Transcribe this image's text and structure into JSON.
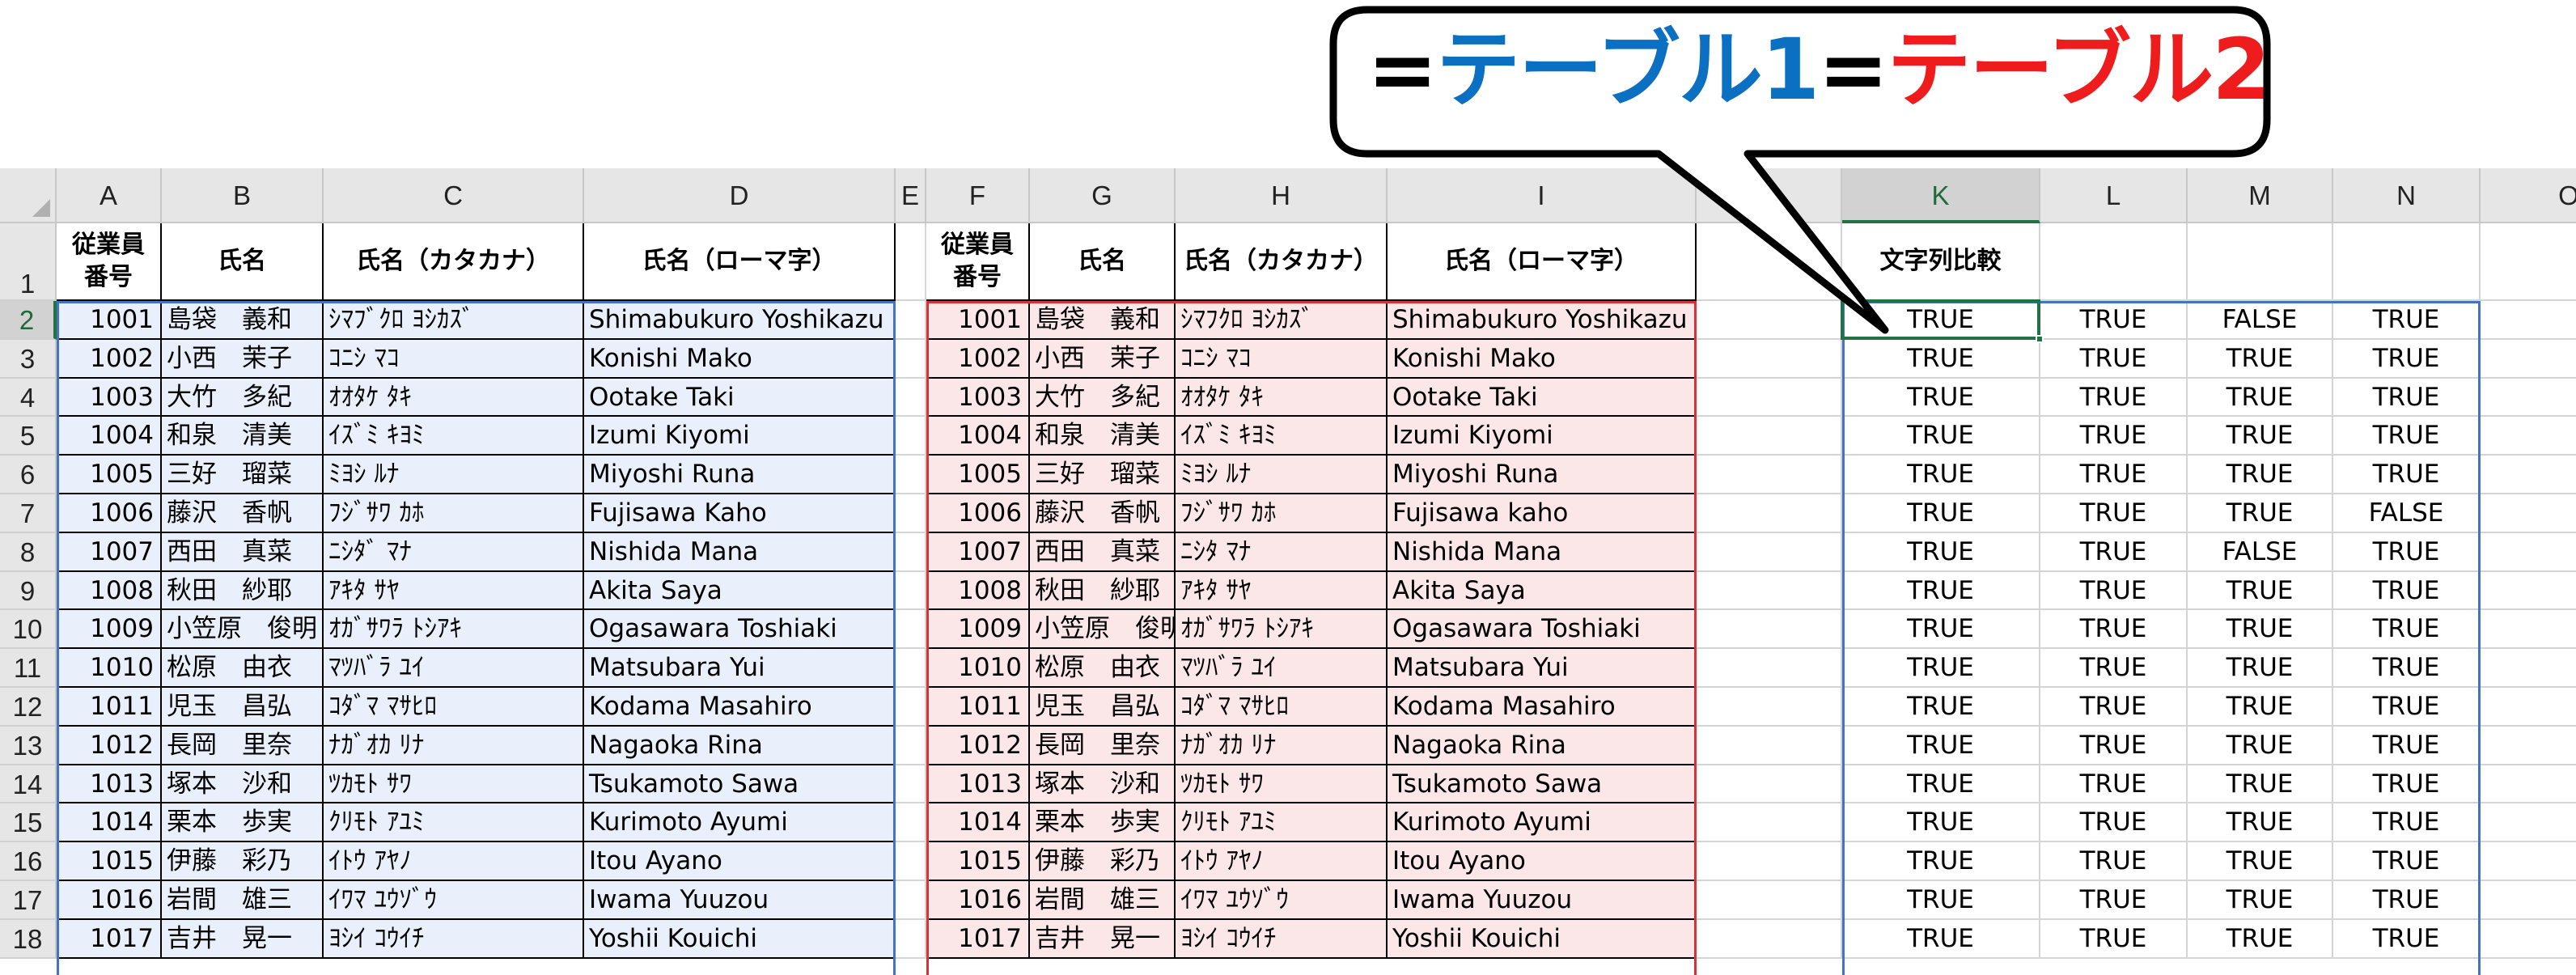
{
  "callout": {
    "eq1": "=",
    "table1": "テーブル1",
    "eq2": "=",
    "table2": "テーブル2",
    "colors": {
      "table1": "#0b6fc2",
      "table2": "#ee1c1c",
      "eq": "#000000"
    }
  },
  "sheet": {
    "columns": [
      "A",
      "B",
      "C",
      "D",
      "E",
      "F",
      "G",
      "H",
      "I",
      "J",
      "K",
      "L",
      "M",
      "N",
      "O"
    ],
    "selected_column": "K",
    "selected_row": "2",
    "row_numbers": [
      "1",
      "2",
      "3",
      "4",
      "5",
      "6",
      "7",
      "8",
      "9",
      "10",
      "11",
      "12",
      "13",
      "14",
      "15",
      "16",
      "17",
      "18"
    ],
    "table1_headers": [
      "従業員番号",
      "氏名",
      "氏名（カタカナ）",
      "氏名（ローマ字）"
    ],
    "table2_headers": [
      "従業員番号",
      "氏名",
      "氏名（カタカナ）",
      "氏名（ローマ字）"
    ],
    "compare_header": "文字列比較",
    "table1_rows": [
      [
        "1001",
        "島袋　義和",
        "ｼﾏﾌﾞｸﾛ ﾖｼｶｽﾞ",
        "Shimabukuro Yoshikazu"
      ],
      [
        "1002",
        "小西　茉子",
        "ｺﾆｼ ﾏｺ",
        "Konishi Mako"
      ],
      [
        "1003",
        "大竹　多紀",
        "ｵｵﾀｹ ﾀｷ",
        "Ootake Taki"
      ],
      [
        "1004",
        "和泉　清美",
        "ｲｽﾞﾐ ｷﾖﾐ",
        "Izumi Kiyomi"
      ],
      [
        "1005",
        "三好　瑠菜",
        "ﾐﾖｼ ﾙﾅ",
        "Miyoshi Runa"
      ],
      [
        "1006",
        "藤沢　香帆",
        "ﾌｼﾞｻﾜ ｶﾎ",
        "Fujisawa Kaho"
      ],
      [
        "1007",
        "西田　真菜",
        "ﾆｼﾀﾞ ﾏﾅ",
        "Nishida Mana"
      ],
      [
        "1008",
        "秋田　紗耶",
        "ｱｷﾀ ｻﾔ",
        "Akita Saya"
      ],
      [
        "1009",
        "小笠原　俊明",
        "ｵｶﾞｻﾜﾗ ﾄｼｱｷ",
        "Ogasawara Toshiaki"
      ],
      [
        "1010",
        "松原　由衣",
        "ﾏﾂﾊﾞﾗ ﾕｲ",
        "Matsubara Yui"
      ],
      [
        "1011",
        "児玉　昌弘",
        "ｺﾀﾞﾏ ﾏｻﾋﾛ",
        "Kodama Masahiro"
      ],
      [
        "1012",
        "長岡　里奈",
        "ﾅｶﾞｵｶ ﾘﾅ",
        "Nagaoka Rina"
      ],
      [
        "1013",
        "塚本　沙和",
        "ﾂｶﾓﾄ ｻﾜ",
        "Tsukamoto Sawa"
      ],
      [
        "1014",
        "栗本　歩実",
        "ｸﾘﾓﾄ ｱﾕﾐ",
        "Kurimoto Ayumi"
      ],
      [
        "1015",
        "伊藤　彩乃",
        "ｲﾄｳ ｱﾔﾉ",
        "Itou Ayano"
      ],
      [
        "1016",
        "岩間　雄三",
        "ｲﾜﾏ ﾕｳｿﾞｳ",
        "Iwama Yuuzou"
      ],
      [
        "1017",
        "吉井　晃一",
        "ﾖｼｲ ｺｳｲﾁ",
        "Yoshii Kouichi"
      ]
    ],
    "table2_rows": [
      [
        "1001",
        "島袋　義和",
        "ｼﾏﾌｸﾛ ﾖｼｶｽﾞ",
        "Shimabukuro Yoshikazu"
      ],
      [
        "1002",
        "小西　茉子",
        "ｺﾆｼ ﾏｺ",
        "Konishi Mako"
      ],
      [
        "1003",
        "大竹　多紀",
        "ｵｵﾀｹ ﾀｷ",
        "Ootake Taki"
      ],
      [
        "1004",
        "和泉　清美",
        "ｲｽﾞﾐ ｷﾖﾐ",
        "Izumi Kiyomi"
      ],
      [
        "1005",
        "三好　瑠菜",
        "ﾐﾖｼ ﾙﾅ",
        "Miyoshi Runa"
      ],
      [
        "1006",
        "藤沢　香帆",
        "ﾌｼﾞｻﾜ ｶﾎ",
        "Fujisawa kaho"
      ],
      [
        "1007",
        "西田　真菜",
        "ﾆｼﾀ ﾏﾅ",
        "Nishida Mana"
      ],
      [
        "1008",
        "秋田　紗耶",
        "ｱｷﾀ ｻﾔ",
        "Akita Saya"
      ],
      [
        "1009",
        "小笠原　俊明",
        "ｵｶﾞｻﾜﾗ ﾄｼｱｷ",
        "Ogasawara Toshiaki"
      ],
      [
        "1010",
        "松原　由衣",
        "ﾏﾂﾊﾞﾗ ﾕｲ",
        "Matsubara Yui"
      ],
      [
        "1011",
        "児玉　昌弘",
        "ｺﾀﾞﾏ ﾏｻﾋﾛ",
        "Kodama Masahiro"
      ],
      [
        "1012",
        "長岡　里奈",
        "ﾅｶﾞｵｶ ﾘﾅ",
        "Nagaoka Rina"
      ],
      [
        "1013",
        "塚本　沙和",
        "ﾂｶﾓﾄ ｻﾜ",
        "Tsukamoto Sawa"
      ],
      [
        "1014",
        "栗本　歩実",
        "ｸﾘﾓﾄ ｱﾕﾐ",
        "Kurimoto Ayumi"
      ],
      [
        "1015",
        "伊藤　彩乃",
        "ｲﾄｳ ｱﾔﾉ",
        "Itou Ayano"
      ],
      [
        "1016",
        "岩間　雄三",
        "ｲﾜﾏ ﾕｳｿﾞｳ",
        "Iwama Yuuzou"
      ],
      [
        "1017",
        "吉井　晃一",
        "ﾖｼｲ ｺｳｲﾁ",
        "Yoshii Kouichi"
      ]
    ],
    "compare_rows": [
      [
        "TRUE",
        "TRUE",
        "FALSE",
        "TRUE"
      ],
      [
        "TRUE",
        "TRUE",
        "TRUE",
        "TRUE"
      ],
      [
        "TRUE",
        "TRUE",
        "TRUE",
        "TRUE"
      ],
      [
        "TRUE",
        "TRUE",
        "TRUE",
        "TRUE"
      ],
      [
        "TRUE",
        "TRUE",
        "TRUE",
        "TRUE"
      ],
      [
        "TRUE",
        "TRUE",
        "TRUE",
        "FALSE"
      ],
      [
        "TRUE",
        "TRUE",
        "FALSE",
        "TRUE"
      ],
      [
        "TRUE",
        "TRUE",
        "TRUE",
        "TRUE"
      ],
      [
        "TRUE",
        "TRUE",
        "TRUE",
        "TRUE"
      ],
      [
        "TRUE",
        "TRUE",
        "TRUE",
        "TRUE"
      ],
      [
        "TRUE",
        "TRUE",
        "TRUE",
        "TRUE"
      ],
      [
        "TRUE",
        "TRUE",
        "TRUE",
        "TRUE"
      ],
      [
        "TRUE",
        "TRUE",
        "TRUE",
        "TRUE"
      ],
      [
        "TRUE",
        "TRUE",
        "TRUE",
        "TRUE"
      ],
      [
        "TRUE",
        "TRUE",
        "TRUE",
        "TRUE"
      ],
      [
        "TRUE",
        "TRUE",
        "TRUE",
        "TRUE"
      ],
      [
        "TRUE",
        "TRUE",
        "TRUE",
        "TRUE"
      ]
    ],
    "colors": {
      "table1_fill": "#e9f0fb",
      "table1_border": "#4472c4",
      "table2_fill": "#fbe6e8",
      "table2_border": "#d9313a",
      "selection": "#217346"
    }
  }
}
